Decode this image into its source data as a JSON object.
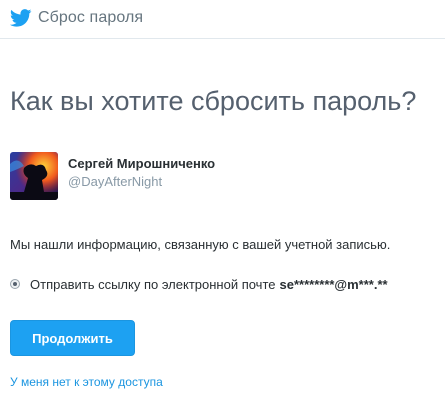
{
  "header": {
    "title": "Сброс пароля",
    "logo_icon": "twitter-bird-icon",
    "brand_color": "#1da1f2"
  },
  "main": {
    "heading": "Как вы хотите сбросить пароль?",
    "user": {
      "name": "Сергей Мирошниченко",
      "handle": "@DayAfterNight",
      "avatar_icon": "user-avatar-image"
    },
    "info_text": "Мы нашли информацию, связанную с вашей учетной записью.",
    "option": {
      "label": "Отправить ссылку по электронной почте",
      "email": "se********@m***.**",
      "selected": true
    },
    "continue_label": "Продолжить",
    "no_access_link": "У меня нет к этому доступа"
  }
}
